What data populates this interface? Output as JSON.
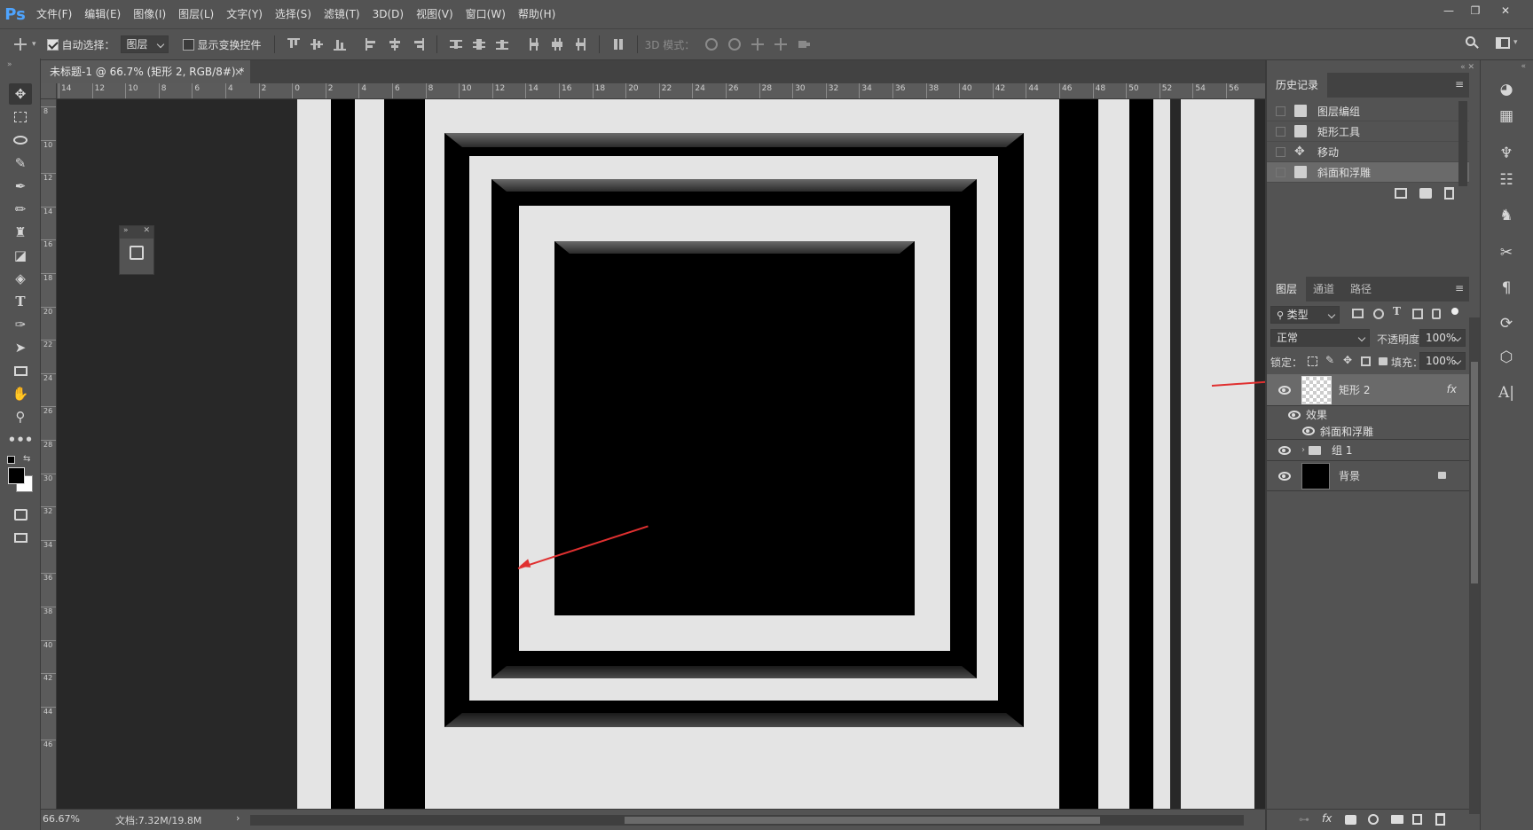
{
  "app": {
    "logo": "Ps"
  },
  "menu": [
    "文件(F)",
    "编辑(E)",
    "图像(I)",
    "图层(L)",
    "文字(Y)",
    "选择(S)",
    "滤镜(T)",
    "3D(D)",
    "视图(V)",
    "窗口(W)",
    "帮助(H)"
  ],
  "window_controls": {
    "minimize": "—",
    "restore": "❐",
    "close": "✕"
  },
  "options": {
    "auto_select_label": "自动选择：",
    "auto_select_value": "图层",
    "show_transform_label": "显示变换控件",
    "mode3d_label": "3D 模式："
  },
  "document": {
    "tab_title": "未标题-1 @ 66.7% (矩形 2, RGB/8#) *",
    "tab_close": "×"
  },
  "ruler": {
    "top_ticks": [
      "14",
      "12",
      "10",
      "8",
      "6",
      "4",
      "2",
      "0",
      "2",
      "4",
      "6",
      "8",
      "10",
      "12",
      "14",
      "16",
      "18",
      "20",
      "22",
      "24",
      "26",
      "28",
      "30",
      "32",
      "34",
      "36",
      "38",
      "40",
      "42",
      "44",
      "46",
      "48",
      "50",
      "52",
      "54",
      "56"
    ],
    "left_ticks": [
      "8",
      "10",
      "12",
      "14",
      "16",
      "18",
      "20",
      "22",
      "24",
      "26",
      "28",
      "30",
      "32",
      "34",
      "36",
      "38",
      "40",
      "42",
      "44",
      "46"
    ]
  },
  "status": {
    "zoom": "66.67%",
    "doc_info": "文档:7.32M/19.8M",
    "arrow": "›"
  },
  "history_panel": {
    "title": "历史记录",
    "items": [
      "图层编组",
      "矩形工具",
      "移动",
      "斜面和浮雕"
    ]
  },
  "layers_panel": {
    "tabs": [
      "图层",
      "通道",
      "路径"
    ],
    "filter_label": "类型",
    "blend_mode": "正常",
    "opacity_label": "不透明度：",
    "opacity_value": "100%",
    "lock_label": "锁定：",
    "fill_label": "填充：",
    "fill_value": "100%",
    "layers": [
      {
        "name": "矩形 2",
        "fx": "fx"
      },
      {
        "name": "效果"
      },
      {
        "name": "斜面和浮雕"
      },
      {
        "name": "组 1"
      },
      {
        "name": "背景"
      }
    ]
  },
  "colors": {
    "accent_arrow": "#e03030",
    "canvas_light": "#e4e4e4",
    "canvas_dark": "#000000",
    "workspace": "#282828"
  }
}
